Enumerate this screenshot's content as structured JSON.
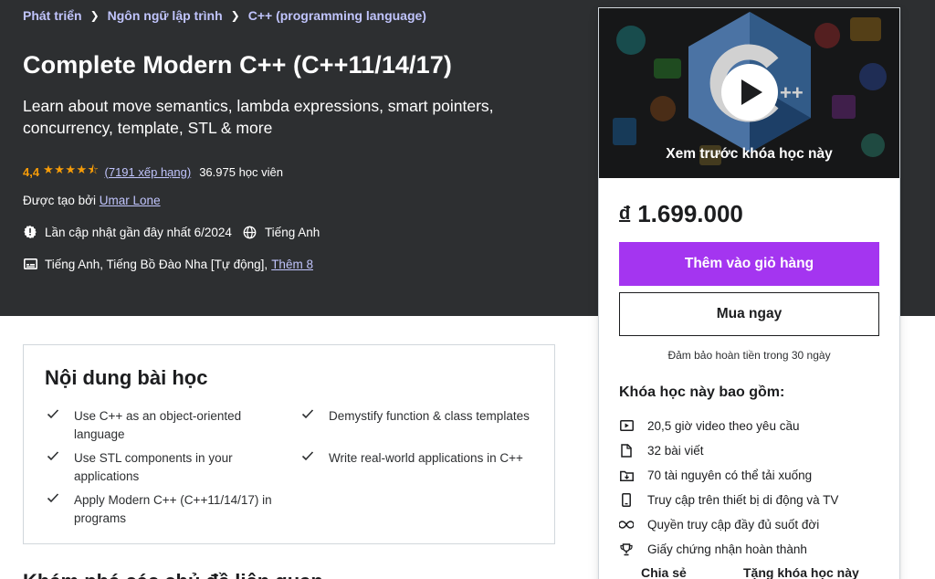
{
  "breadcrumb": {
    "items": [
      "Phát triển",
      "Ngôn ngữ lập trình",
      "C++ (programming language)"
    ]
  },
  "course": {
    "title": "Complete Modern C++ (C++11/14/17)",
    "subtitle": "Learn about move semantics, lambda expressions, smart pointers, concurrency, template, STL & more",
    "rating": "4,4",
    "rating_value": 4.4,
    "rating_count": "(7191 xếp hạng)",
    "students": "36.975 học viên",
    "created_by_label": "Được tạo bởi",
    "instructor": "Umar Lone",
    "last_updated": "Lần cập nhật gần đây nhất 6/2024",
    "language": "Tiếng Anh",
    "captions": "Tiếng Anh, Tiếng Bồ Đào Nha [Tự động],",
    "captions_more": "Thêm 8"
  },
  "card": {
    "preview_label": "Xem trước khóa học này",
    "currency": "đ",
    "price": "1.699.000",
    "add_to_cart": "Thêm vào giỏ hàng",
    "buy_now": "Mua ngay",
    "guarantee": "Đảm bảo hoàn tiền trong 30 ngày",
    "includes_title": "Khóa học này bao gồm:",
    "includes": [
      {
        "icon": "video-icon",
        "label": "20,5 giờ video theo yêu cầu"
      },
      {
        "icon": "file-icon",
        "label": "32 bài viết"
      },
      {
        "icon": "download-icon",
        "label": "70 tài nguyên có thể tải xuống"
      },
      {
        "icon": "mobile-icon",
        "label": "Truy cập trên thiết bị di động và TV"
      },
      {
        "icon": "infinity-icon",
        "label": "Quyền truy cập đầy đủ suốt đời"
      },
      {
        "icon": "trophy-icon",
        "label": "Giấy chứng nhận hoàn thành"
      }
    ],
    "share": "Chia sẻ",
    "gift": "Tặng khóa học này"
  },
  "learn": {
    "title": "Nội dung bài học",
    "items": [
      "Use C++ as an object-oriented language",
      "Demystify function & class templates",
      "Use STL components in your applications",
      "Write real-world applications in C++",
      "Apply Modern C++ (C++11/14/17) in programs"
    ]
  },
  "next_section_title": "Khám phá các chủ đề liên quan",
  "colors": {
    "hero_bg": "#2d2f31",
    "accent_purple": "#a435f0",
    "link_lavender": "#c0c4fc",
    "star_orange": "#f69c08"
  }
}
